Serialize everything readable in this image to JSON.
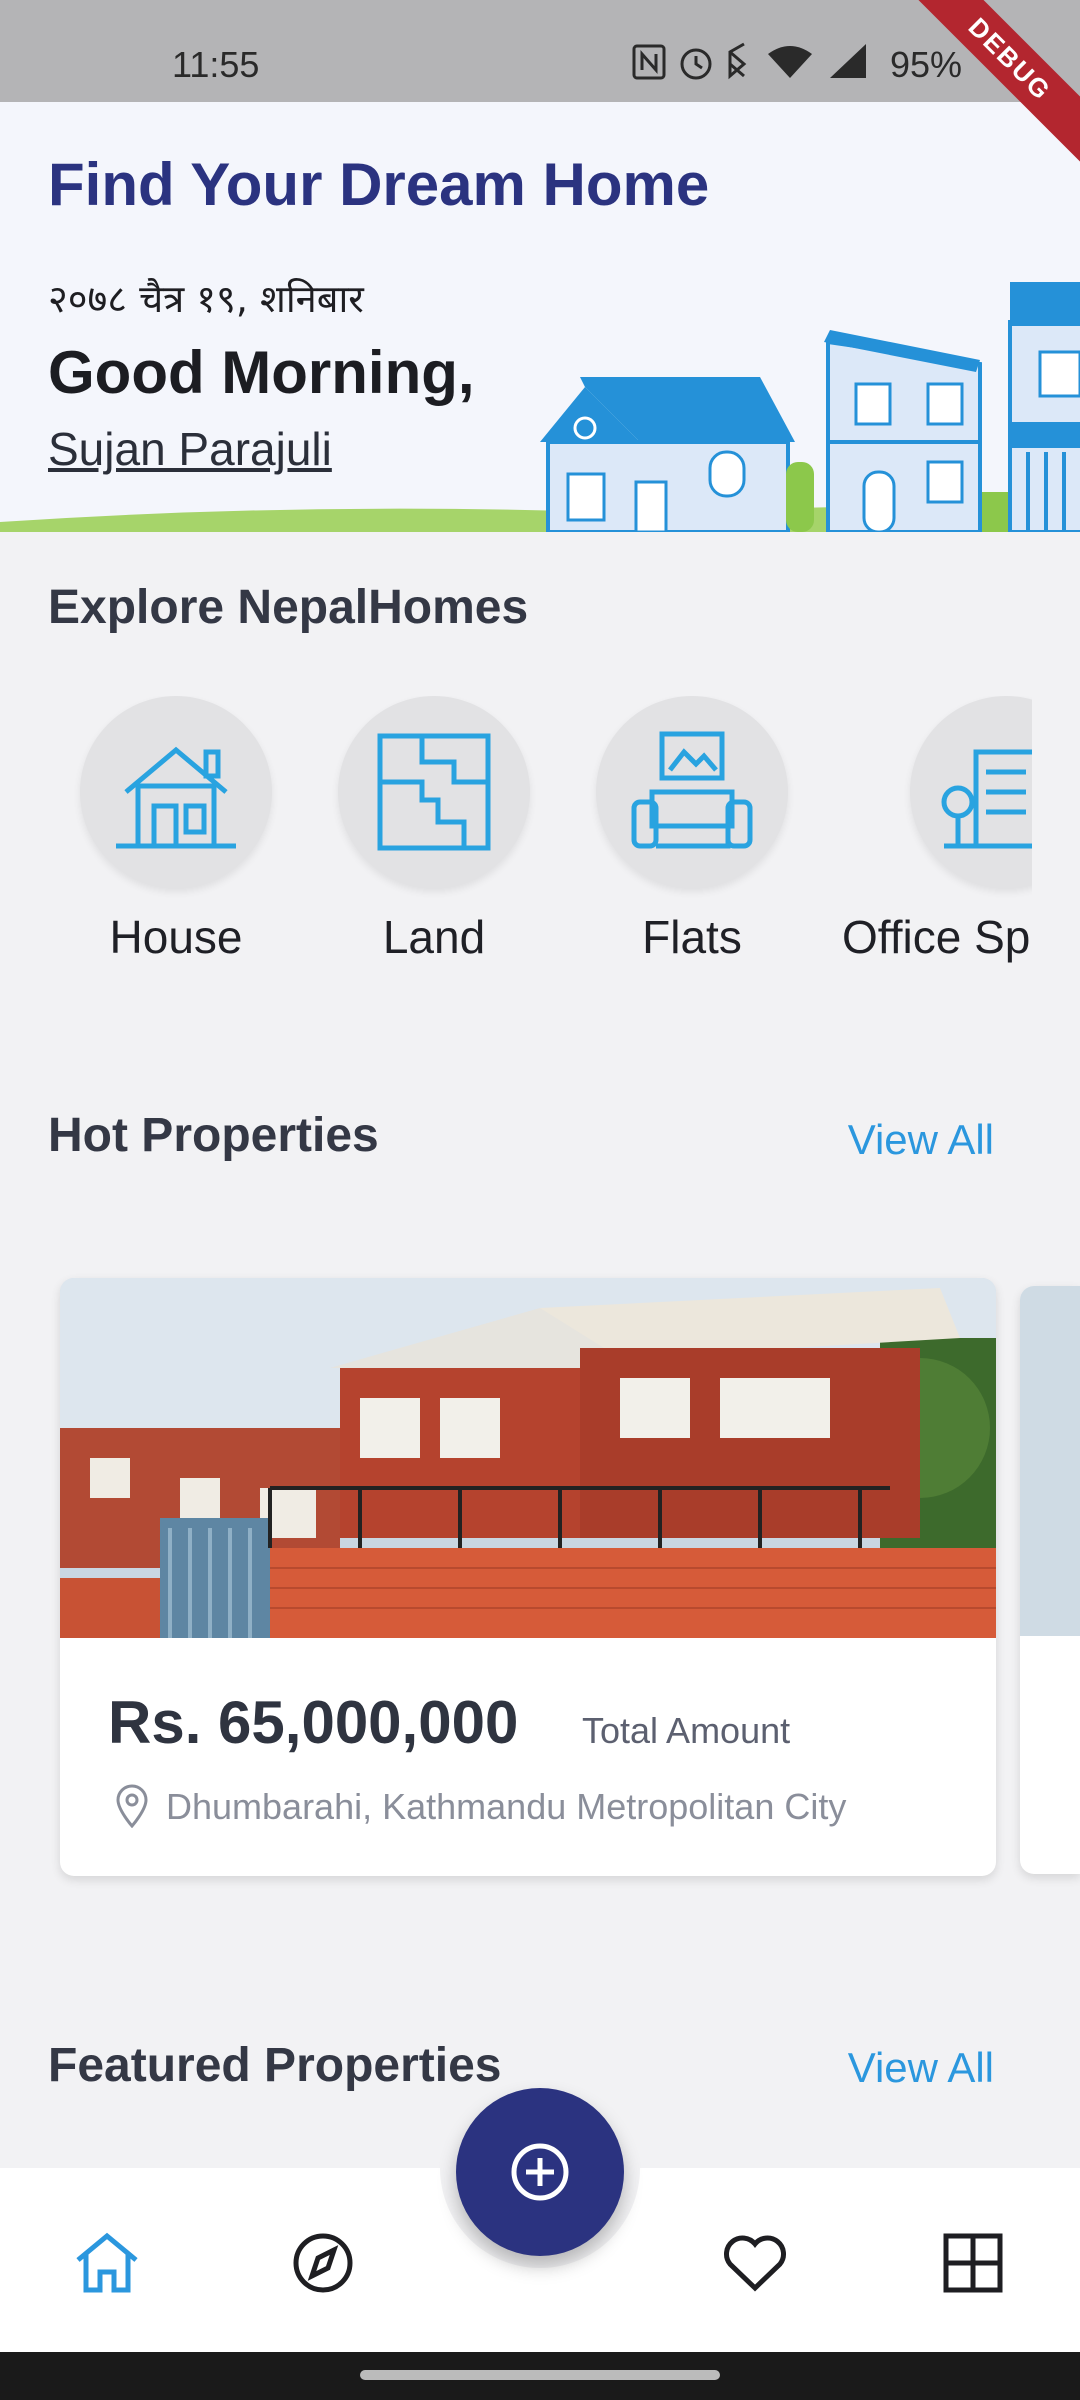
{
  "status_bar": {
    "time": "11:55",
    "battery": "95%",
    "icons": [
      "nfc-icon",
      "alarm-icon",
      "bluetooth-icon",
      "wifi-icon",
      "signal-icon"
    ]
  },
  "debug_banner": "DEBUG",
  "hero": {
    "title": "Find Your Dream Home",
    "date": "२०७८ चैत्र १९, शनिबार",
    "greeting": "Good Morning,",
    "user_name": "Sujan Parajuli"
  },
  "explore": {
    "title": "Explore NepalHomes",
    "categories": [
      {
        "label": "House",
        "icon": "house-icon"
      },
      {
        "label": "Land",
        "icon": "land-plot-icon"
      },
      {
        "label": "Flats",
        "icon": "sofa-icon"
      },
      {
        "label": "Office Space",
        "icon": "office-building-icon"
      }
    ]
  },
  "hot_properties": {
    "title": "Hot Properties",
    "view_all": "View All",
    "items": [
      {
        "price": "Rs. 65,000,000",
        "price_label": "Total Amount",
        "location": "Dhumbarahi, Kathmandu Metropolitan City"
      }
    ]
  },
  "featured_properties": {
    "title": "Featured Properties",
    "view_all": "View All"
  },
  "bottom_nav": {
    "items": [
      "home-icon",
      "compass-icon",
      "add-circle-icon",
      "heart-icon",
      "grid-icon"
    ],
    "active": "home-icon"
  },
  "colors": {
    "primary": "#2b3380",
    "accent": "#2b97de",
    "icon_blue": "#29a3e0"
  }
}
